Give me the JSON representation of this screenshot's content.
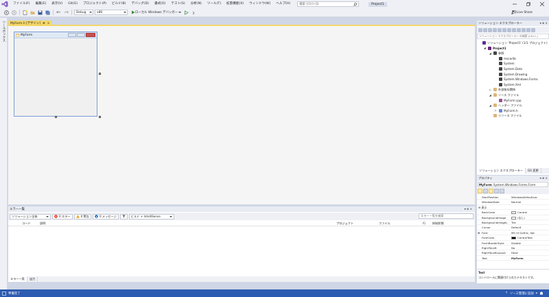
{
  "menubar": {
    "items": [
      "ファイル(F)",
      "編集(E)",
      "表示(V)",
      "Git(G)",
      "プロジェクト(P)",
      "ビルド(B)",
      "デバッグ(D)",
      "書式(O)",
      "テスト(S)",
      "分析(N)",
      "ツール(T)",
      "拡張機能(X)",
      "ウィンドウ(W)",
      "ヘルプ(H)"
    ],
    "search_placeholder": "検索 (Ctrl+Q)",
    "project_name": "Project1"
  },
  "toolbar": {
    "config": "Debug",
    "platform": "x86",
    "run_label": "ローカル Windows デバッガー",
    "liveshare_label": "Live Share"
  },
  "leftrail": {
    "toolbox_label": "ツールボックス"
  },
  "document": {
    "tab_label": "MyForm.h [デザイン]",
    "tab_pin": "⊕",
    "tab_close": "×",
    "form_title": "MyForm"
  },
  "errorlist": {
    "title": "エラー一覧",
    "scope": "ソリューション全体",
    "errors": "0 エラー",
    "warnings": "0 警告",
    "messages": "0 メッセージ",
    "build_filter": "ビルド + IntelliSense",
    "search_placeholder": "エラー一覧を検索",
    "columns": [
      "コード",
      "説明",
      "プロジェクト",
      "ファイル",
      "行",
      "抑制状態"
    ],
    "tabs": [
      "エラー一覧",
      "出力"
    ]
  },
  "solution": {
    "title": "ソリューション エクスプローラー",
    "search_placeholder": "ソリューション エクスプローラー の検索 (Ctrl+;)",
    "tree": [
      {
        "label": "ソリューション 'Project1' (1/1 プロジェクト)",
        "indent": 0,
        "expander": "",
        "color": "#5c2d91"
      },
      {
        "label": "Project1",
        "indent": 1,
        "expander": "◢",
        "color": "#68217a",
        "bold": true
      },
      {
        "label": "参照",
        "indent": 2,
        "expander": "◢",
        "color": "#444444"
      },
      {
        "label": "mscorlib",
        "indent": 3,
        "expander": "",
        "color": "#444444"
      },
      {
        "label": "System",
        "indent": 3,
        "expander": "",
        "color": "#444444"
      },
      {
        "label": "System.Data",
        "indent": 3,
        "expander": "",
        "color": "#444444"
      },
      {
        "label": "System.Drawing",
        "indent": 3,
        "expander": "",
        "color": "#444444"
      },
      {
        "label": "System.Windows.Forms",
        "indent": 3,
        "expander": "",
        "color": "#444444"
      },
      {
        "label": "System.Xml",
        "indent": 3,
        "expander": "",
        "color": "#444444"
      },
      {
        "label": "外部依存関係",
        "indent": 2,
        "expander": "▷",
        "color": "#dcb67a"
      },
      {
        "label": "ソース ファイル",
        "indent": 2,
        "expander": "◢",
        "color": "#dcb67a"
      },
      {
        "label": "MyForm.cpp",
        "indent": 3,
        "expander": "",
        "color": "#9b4f96"
      },
      {
        "label": "ヘッダー ファイル",
        "indent": 2,
        "expander": "◢",
        "color": "#dcb67a"
      },
      {
        "label": "MyForm.h",
        "indent": 3,
        "expander": "▷",
        "color": "#6a8ad8"
      },
      {
        "label": "リソース ファイル",
        "indent": 2,
        "expander": "",
        "color": "#dcb67a"
      }
    ],
    "tabs": [
      "ソリューション エクスプローラー",
      "Git 変更"
    ]
  },
  "properties": {
    "title": "プロパティ",
    "object_name": "MyForm",
    "object_type": "System.Windows.Forms.Form",
    "rows": [
      {
        "name": "StartPosition",
        "value": "WindowsDefaultLoc"
      },
      {
        "name": "WindowState",
        "value": "Normal"
      },
      {
        "name": "表示",
        "value": "",
        "category": true
      },
      {
        "name": "BackColor",
        "value": "Control",
        "swatch": "#f0f0f0"
      },
      {
        "name": "BackgroundImage",
        "value": "(なし)",
        "swatch": "#ffffff"
      },
      {
        "name": "BackgroundImageL",
        "value": "Tile"
      },
      {
        "name": "Cursor",
        "value": "Default"
      },
      {
        "name": "Font",
        "value": "MS UI Gothic, 9pt",
        "expandable": true
      },
      {
        "name": "ForeColor",
        "value": "ControlText",
        "swatch": "#000000"
      },
      {
        "name": "FormBorderStyle",
        "value": "Sizable"
      },
      {
        "name": "RightToLeft",
        "value": "No"
      },
      {
        "name": "RightToLeftLayout",
        "value": "False"
      },
      {
        "name": "Text",
        "value": "MyForm",
        "boldvalue": true
      },
      {
        "name": "UseWaitCursor",
        "value": "False"
      }
    ],
    "desc_title": "Text",
    "desc_text": "コントロールに関連付けられたテキストです。"
  },
  "status": {
    "ready": "準備完了",
    "add_to_source": "ソース管理に追加"
  }
}
